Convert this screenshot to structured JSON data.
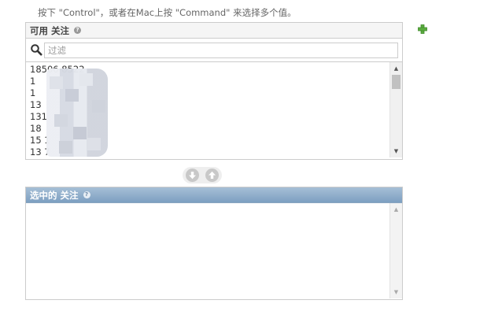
{
  "help_text": "按下 \"Control\"，或者在Mac上按 \"Command\" 来选择多个值。",
  "available": {
    "title": "可用 关注",
    "filter_placeholder": "过滤",
    "filter_value": "",
    "items": [
      "18506 8522",
      "1",
      "1",
      "13",
      "131",
      "18",
      "15 1",
      "13 7"
    ]
  },
  "chosen": {
    "title": "选中的 关注",
    "items": []
  },
  "icons": {
    "add_related": "plus-icon",
    "search": "search-icon",
    "help": "help-icon",
    "choose": "arrow-down-icon",
    "remove": "arrow-up-icon"
  },
  "colors": {
    "chosen_header": "#7d9fc1",
    "add_icon": "#5aac3e"
  }
}
